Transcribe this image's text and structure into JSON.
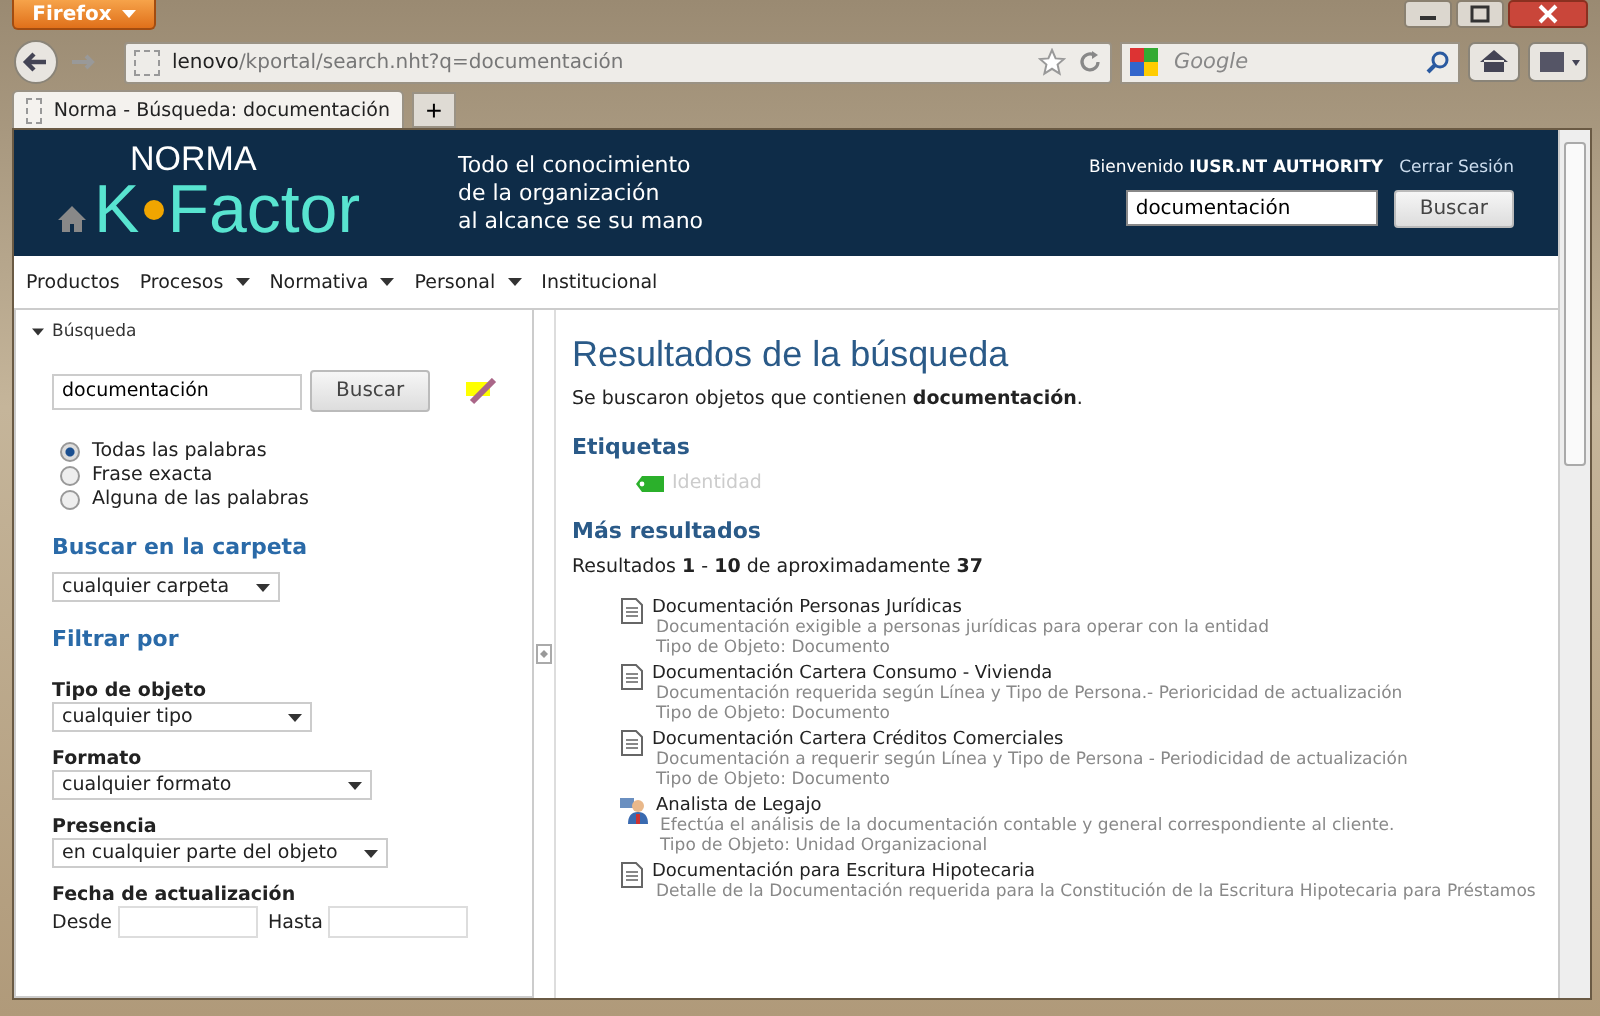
{
  "browser": {
    "menu_button": "Firefox",
    "url_host": "lenovo",
    "url_path": "/kportal/search.nht?q=documentación",
    "search_placeholder": "Google",
    "tab_title": "Norma - Búsqueda: documentación",
    "new_tab": "+"
  },
  "header": {
    "logo_top": "NORMA",
    "logo_left": "K",
    "logo_right": "Factor",
    "tagline": [
      "Todo el conocimiento",
      "de la organización",
      "al alcance se su mano"
    ],
    "welcome": "Bienvenido **IUSR.NT AUTHORITY**",
    "logout": "Cerrar Sesión",
    "search_value": "documentación",
    "search_button": "Buscar"
  },
  "menu": [
    {
      "label": "Productos",
      "dropdown": false
    },
    {
      "label": "Procesos",
      "dropdown": true
    },
    {
      "label": "Normativa",
      "dropdown": true
    },
    {
      "label": "Personal",
      "dropdown": true
    },
    {
      "label": "Institucional",
      "dropdown": false
    }
  ],
  "sidebar": {
    "section": "Búsqueda",
    "search_value": "documentación",
    "search_button": "Buscar",
    "match_options": [
      {
        "label": "Todas las palabras",
        "selected": true
      },
      {
        "label": "Frase exacta",
        "selected": false
      },
      {
        "label": "Alguna de las palabras",
        "selected": false
      }
    ],
    "folder_heading": "Buscar en la carpeta",
    "folder_value": "cualquier carpeta",
    "filter_heading": "Filtrar por",
    "filters": [
      {
        "label": "Tipo de objeto",
        "value": "cualquier tipo"
      },
      {
        "label": "Formato",
        "value": "cualquier formato"
      },
      {
        "label": "Presencia",
        "value": "en cualquier parte del objeto"
      }
    ],
    "date_heading": "Fecha de actualización",
    "date_from": "Desde",
    "date_to": "Hasta"
  },
  "results": {
    "title": "Resultados de la búsqueda",
    "summary": "Se buscaron objetos que contienen **documentación**.",
    "tags_heading": "Etiquetas",
    "tags": [
      "Identidad"
    ],
    "more_heading": "Más resultados",
    "count": "Resultados **1** - **10** de aproximadamente **37**",
    "items": [
      {
        "kind": "document",
        "title": "Documentación Personas Jurídicas",
        "description": "Documentación exigible a personas jurídicas para operar con la entidad",
        "type": "Tipo de Objeto: Documento"
      },
      {
        "kind": "document",
        "title": "Documentación Cartera Consumo - Vivienda",
        "description": "Documentación requerida según Línea y Tipo de Persona.- Perioricidad de actualización",
        "type": "Tipo de Objeto: Documento"
      },
      {
        "kind": "document",
        "title": "Documentación Cartera Créditos Comerciales",
        "description": "Documentación a requerir según Línea y Tipo de Persona - Periodicidad de actualización",
        "type": "Tipo de Objeto: Documento"
      },
      {
        "kind": "person",
        "title": "Analista de Legajo",
        "description": "Efectúa el análisis de la documentación contable y general correspondiente al cliente.",
        "type": "Tipo de Objeto: Unidad Organizacional"
      },
      {
        "kind": "document",
        "title": "Documentación para Escritura Hipotecaria",
        "description": "Detalle de la Documentación requerida para la Constitución de la Escritura Hipotecaria para Préstamos"
      }
    ]
  }
}
